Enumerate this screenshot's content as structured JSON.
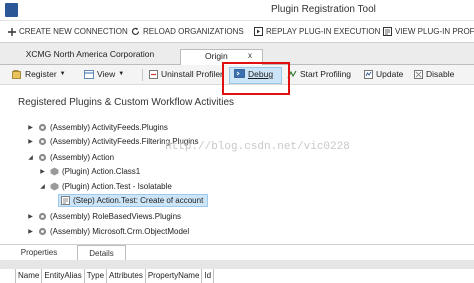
{
  "window": {
    "title": "Plugin Registration Tool"
  },
  "commands": [
    {
      "label": "CREATE NEW CONNECTION",
      "icon": "plus-icon"
    },
    {
      "label": "RELOAD ORGANIZATIONS",
      "icon": "reload-icon"
    },
    {
      "label": "REPLAY PLUG-IN EXECUTION",
      "icon": "replay-icon"
    },
    {
      "label": "VIEW PLUG-IN PROFILE",
      "icon": "profile-icon"
    }
  ],
  "tabs": {
    "connection": "XCMG North America Corporation",
    "org": "Origin",
    "close": "x"
  },
  "toolbar": {
    "register": "Register",
    "view": "View",
    "uninstall_profiler": "Uninstall Profiler",
    "debug": "Debug",
    "start_profiling": "Start Profiling",
    "update": "Update",
    "disable": "Disable"
  },
  "section_title": "Registered Plugins & Custom Workflow Activities",
  "tree": [
    {
      "label": "(Assembly) ActivityFeeds.Plugins",
      "expander": "▶",
      "icon": "assembly-icon"
    },
    {
      "label": "(Assembly) ActivityFeeds.Filtering.Plugins",
      "expander": "▶",
      "icon": "assembly-icon"
    },
    {
      "label": "(Assembly) Action",
      "expander": "◢",
      "icon": "assembly-icon"
    },
    {
      "label": "(Plugin) Action.Class1",
      "expander": "▶",
      "icon": "plugin-icon"
    },
    {
      "label": "(Plugin) Action.Test - Isolatable",
      "expander": "◢",
      "icon": "plugin-icon"
    },
    {
      "label": "(Step) Action.Test: Create of account",
      "expander": "",
      "icon": "step-icon"
    },
    {
      "label": "(Assembly) RoleBasedViews.Plugins",
      "expander": "▶",
      "icon": "assembly-icon"
    },
    {
      "label": "(Assembly) Microsoft.Crm.ObjectModel",
      "expander": "▶",
      "icon": "assembly-icon"
    }
  ],
  "watermark": "http://blog.csdn.net/vic0228",
  "bottom_tabs": {
    "properties": "Properties",
    "details": "Details"
  },
  "grid_columns": [
    "Name",
    "EntityAlias",
    "Type",
    "Attributes",
    "PropertyName",
    "Id"
  ],
  "colors": {
    "highlight": "#e01010",
    "selection": "#cde5f8",
    "accent": "#2b5797"
  }
}
